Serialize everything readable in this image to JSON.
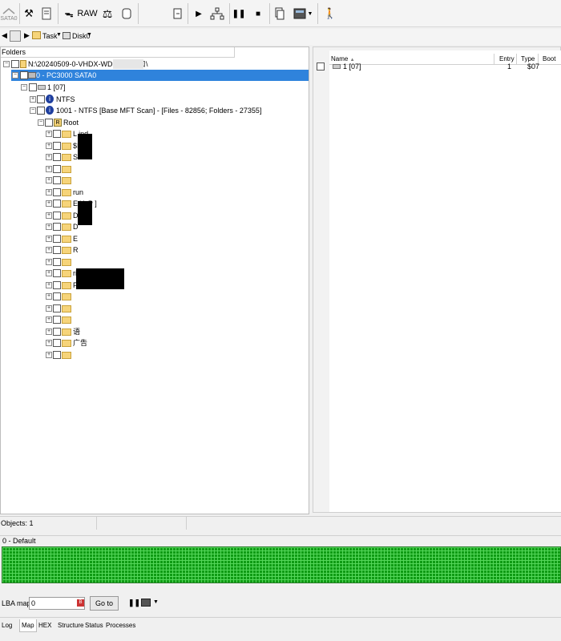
{
  "toolbar": {
    "sata_label": "SATA0",
    "raw_label": "RAW"
  },
  "taskbar": {
    "task_label": "Task",
    "disk_label": "Disk0"
  },
  "folders": {
    "header": "Folders",
    "path": "N:\\20240509-0-VHDX-WD1000-卡扣",
    "path_suffix": "\\",
    "device": "0 - PC3000 SATA0",
    "partition": "1 [07]",
    "fs_ntfs": "NTFS",
    "scan": "1001 - NTFS [Base MFT Scan] - [Files - 82856; Folders - 27355]",
    "root": "Root",
    "items": [
      {
        "label": "L          ind"
      },
      {
        "label": "$I"
      },
      {
        "label": "S                   l"
      },
      {
        "label": ""
      },
      {
        "label": ""
      },
      {
        "label": "     run"
      },
      {
        "label": "E   YuP       ]"
      },
      {
        "label": "D"
      },
      {
        "label": "D"
      },
      {
        "label": "E"
      },
      {
        "label": "R"
      },
      {
        "label": ""
      },
      {
        "label": "                          rial"
      },
      {
        "label": "F"
      },
      {
        "label": ""
      },
      {
        "label": ""
      },
      {
        "label": ""
      },
      {
        "label": "       语"
      },
      {
        "label": "   广告"
      },
      {
        "label": ""
      }
    ]
  },
  "list": {
    "col_name": "Name",
    "col_entry": "Entry",
    "col_type": "Type",
    "col_boot": "Boot",
    "rows": [
      {
        "name": "1 [07]",
        "entry": "1",
        "type": "$07"
      }
    ]
  },
  "status": {
    "objects": "Objects: 1"
  },
  "map": {
    "title": "0 - Default"
  },
  "lba": {
    "label": "LBA map",
    "value": "0",
    "goto_label": "Go to"
  },
  "tabs": [
    "Log",
    "Map",
    "HEX",
    "Structure",
    "Status",
    "Processes"
  ],
  "tabs_active": "Map"
}
